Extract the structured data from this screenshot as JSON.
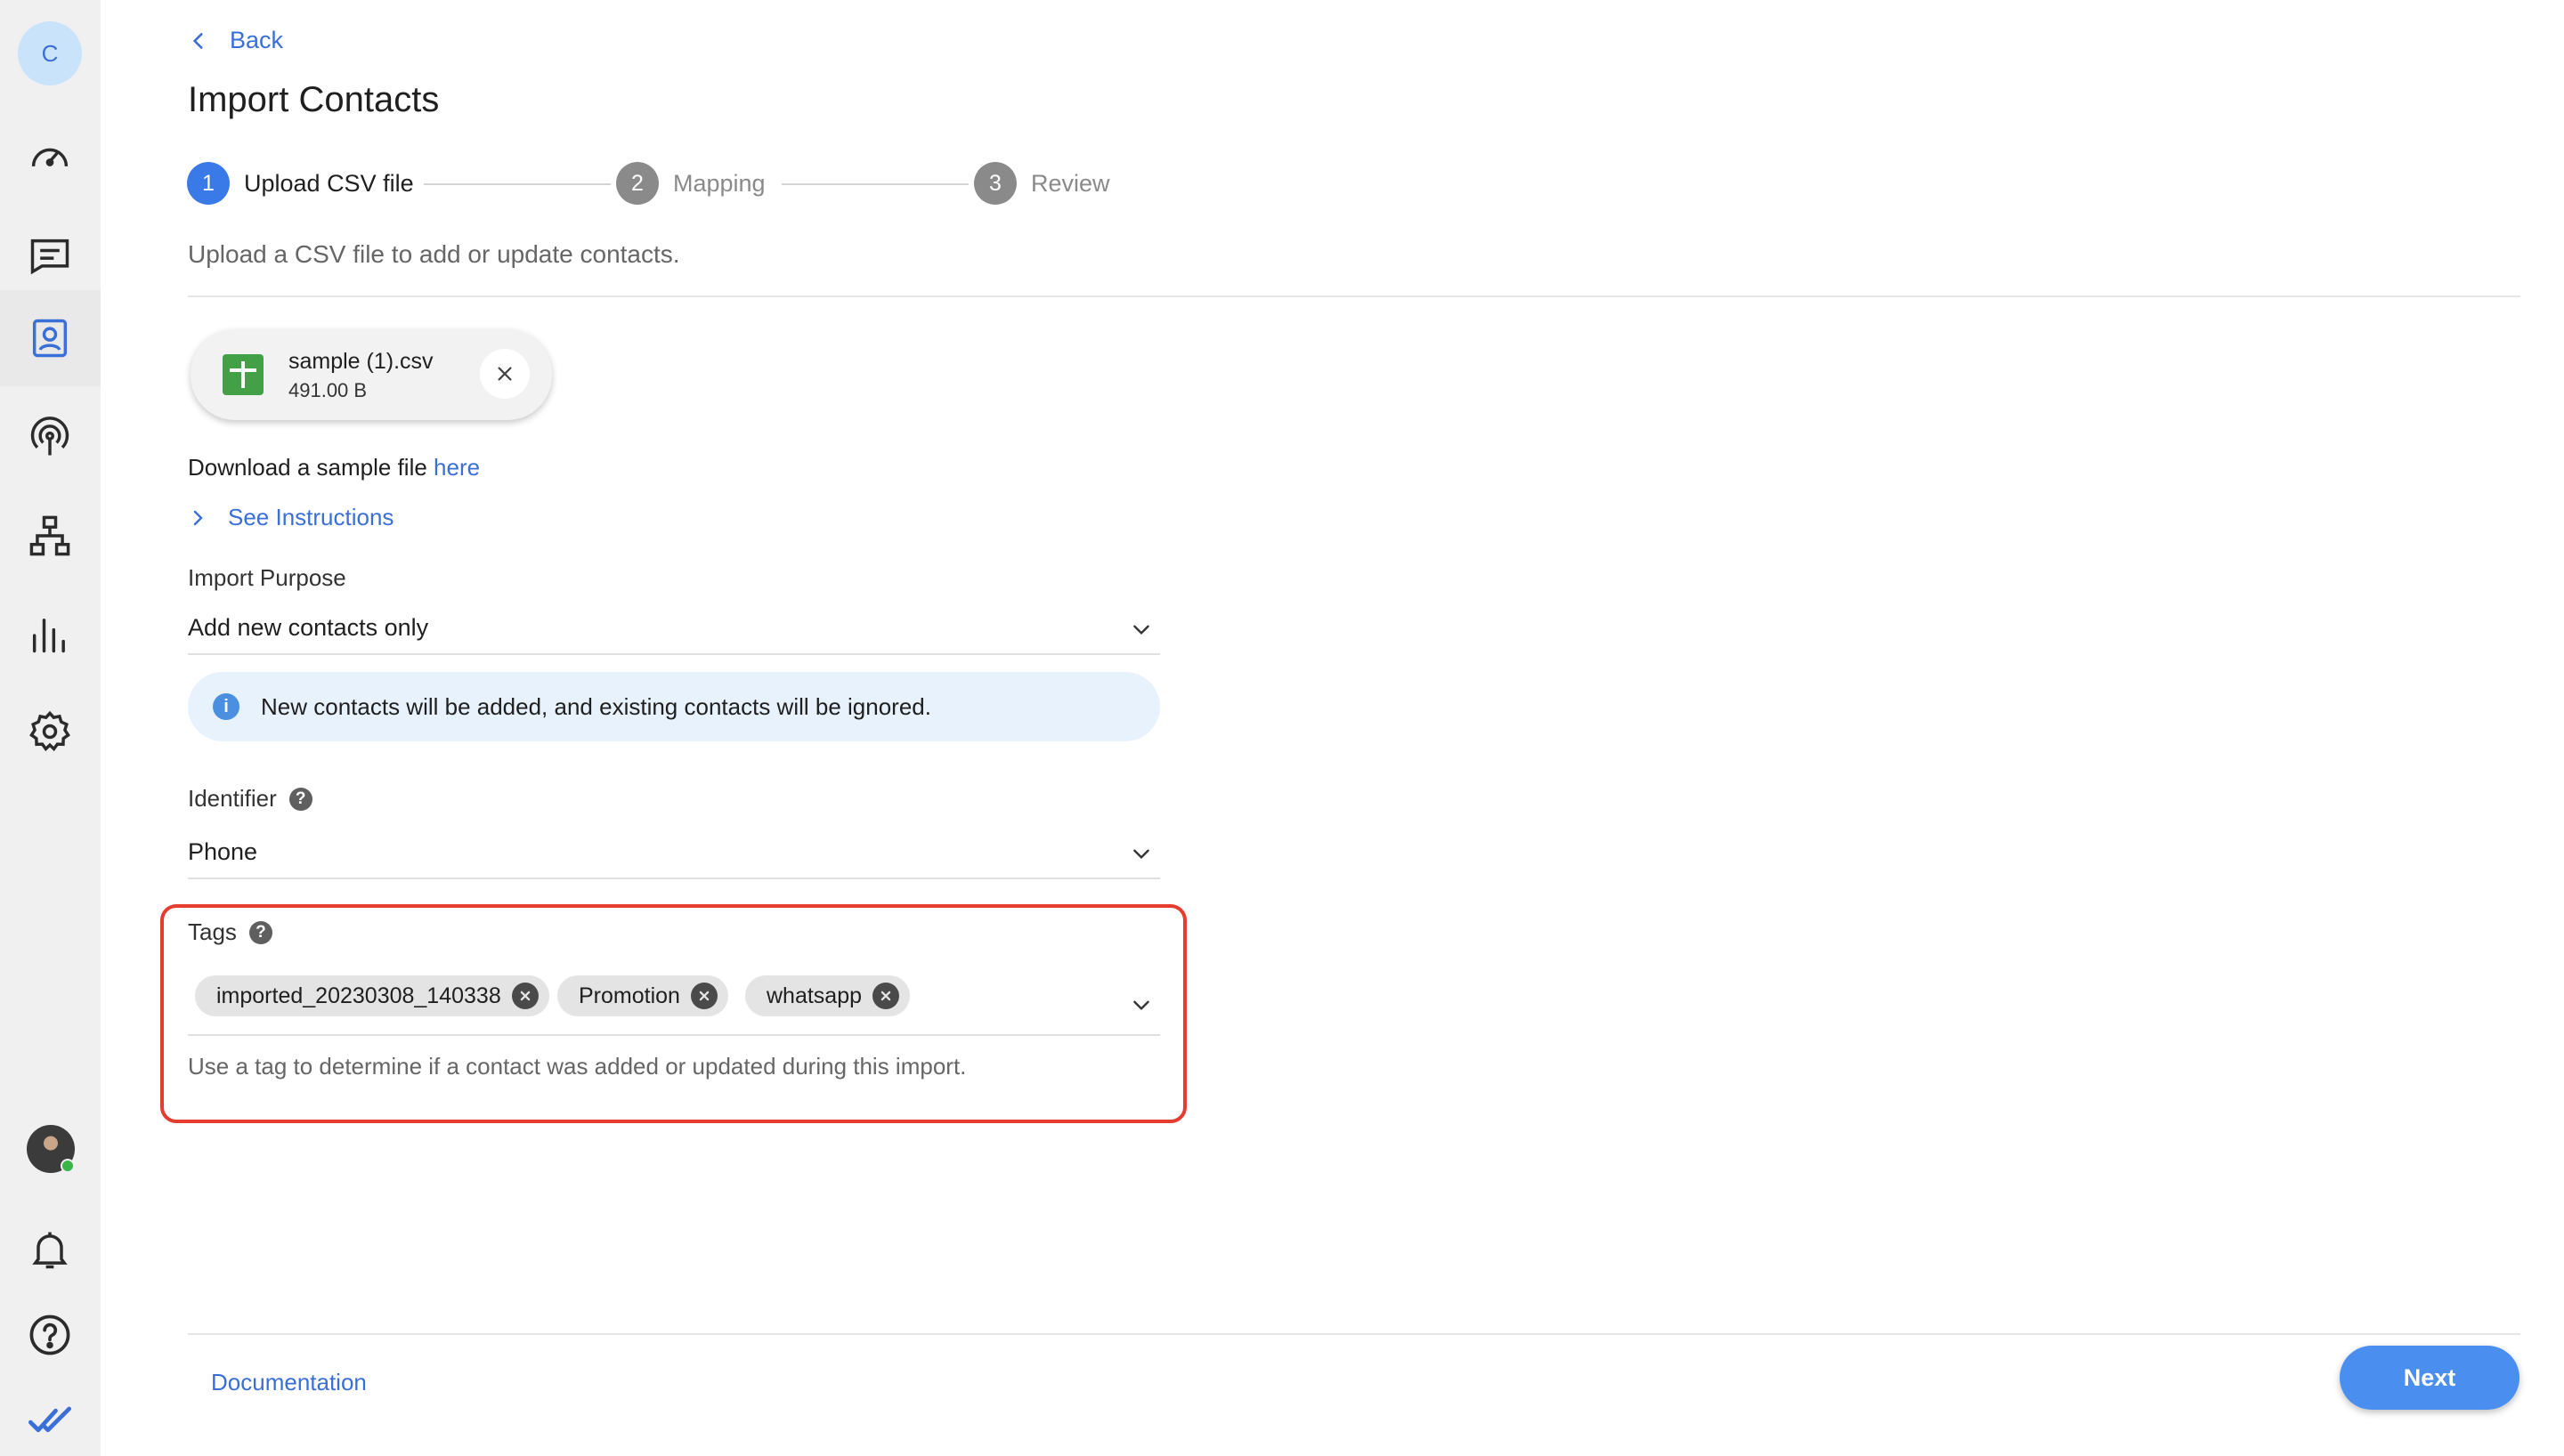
{
  "sidebar": {
    "account_initial": "C",
    "icons": [
      "dashboard-icon",
      "conversations-icon",
      "contacts-icon",
      "broadcast-icon",
      "flows-icon",
      "reports-icon",
      "settings-icon",
      "notifications-icon",
      "help-icon",
      "brand-logo-icon"
    ]
  },
  "header": {
    "back_label": "Back",
    "title": "Import Contacts"
  },
  "stepper": {
    "steps": [
      {
        "number": "1",
        "label": "Upload CSV file",
        "active": true
      },
      {
        "number": "2",
        "label": "Mapping",
        "active": false
      },
      {
        "number": "3",
        "label": "Review",
        "active": false
      }
    ]
  },
  "subtitle": "Upload a CSV file to add or update contacts.",
  "file": {
    "name": "sample (1).csv",
    "size": "491.00 B"
  },
  "download": {
    "text": "Download a sample file ",
    "link": "here"
  },
  "instructions_label": "See Instructions",
  "import_purpose": {
    "label": "Import Purpose",
    "value": "Add new contacts only",
    "info": "New contacts will be added, and existing contacts will be ignored."
  },
  "identifier": {
    "label": "Identifier",
    "value": "Phone"
  },
  "tags": {
    "label": "Tags",
    "items": [
      "imported_20230308_140338",
      "Promotion",
      "whatsapp"
    ],
    "help": "Use a tag to determine if a contact was added or updated during this import."
  },
  "footer": {
    "documentation": "Documentation",
    "next": "Next"
  },
  "colors": {
    "accent": "#3a6fd8",
    "primary_button": "#4a8ff0",
    "highlight_border": "#e43d30",
    "info_bg": "#e8f2fc"
  }
}
